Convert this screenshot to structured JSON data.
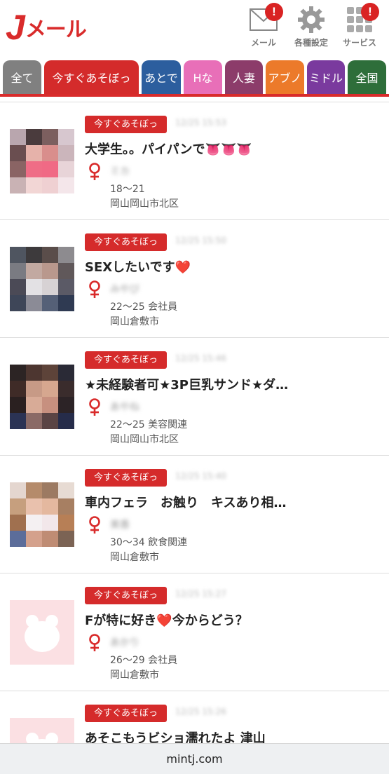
{
  "header": {
    "logo_j": "J",
    "logo_rest": "メール",
    "buttons": [
      {
        "label": "メール",
        "icon": "mail-icon",
        "badge": "!"
      },
      {
        "label": "各種設定",
        "icon": "gear-icon"
      },
      {
        "label": "サービス",
        "icon": "grid-icon",
        "badge": "!"
      }
    ]
  },
  "tabs": [
    {
      "label": "全て",
      "color": "#808080"
    },
    {
      "label": "今すぐあそぼっ",
      "color": "#d42b2b"
    },
    {
      "label": "あとで",
      "color": "#2c5e9e"
    },
    {
      "label": "Hな",
      "color": "#e86fb8"
    },
    {
      "label": "人妻",
      "color": "#8c3c6a"
    },
    {
      "label": "アブノ",
      "color": "#ec7a2a"
    },
    {
      "label": "ミドル",
      "color": "#7a3a9e"
    },
    {
      "label": "全国",
      "color": "#2e6e3a"
    }
  ],
  "posts": [
    {
      "category": "今すぐあそぼっ",
      "time": "12/25 15:53",
      "title": "大学生。。パイパンで👅👅👅",
      "nickname": "ミカ",
      "meta": "18〜21",
      "area": "岡山岡山市北区",
      "thumb": "photo1"
    },
    {
      "category": "今すぐあそぼっ",
      "time": "12/25 15:50",
      "title": "SEXしたいです❤️",
      "nickname": "みやび",
      "meta": "22〜25 会社員",
      "area": "岡山倉敷市",
      "thumb": "photo2"
    },
    {
      "category": "今すぐあそぼっ",
      "time": "12/25 15:46",
      "title": "★未経験者可★3P巨乳サンド★ダ…",
      "nickname": "あやね",
      "meta": "22〜25 美容関連",
      "area": "岡山岡山市北区",
      "thumb": "photo3"
    },
    {
      "category": "今すぐあそぼっ",
      "time": "12/25 15:40",
      "title": "車内フェラ　お触り　キスあり相…",
      "nickname": "美香",
      "meta": "30〜34 飲食関連",
      "area": "岡山倉敷市",
      "thumb": "photo4"
    },
    {
      "category": "今すぐあそぼっ",
      "time": "12/25 15:27",
      "title": "Fが特に好き❤️今からどう？",
      "nickname": "あかり",
      "meta": "26〜29 会社員",
      "area": "岡山倉敷市",
      "thumb": "placeholder"
    },
    {
      "category": "今すぐあそぼっ",
      "time": "12/25 15:26",
      "title": "あそこもうビショ濡れたよ 津山",
      "nickname": "",
      "meta": "",
      "area": "",
      "thumb": "placeholder"
    }
  ],
  "footer": {
    "url": "mintj.com"
  },
  "colors": {
    "accent": "#d92b2b",
    "female": "#d92b2b"
  }
}
